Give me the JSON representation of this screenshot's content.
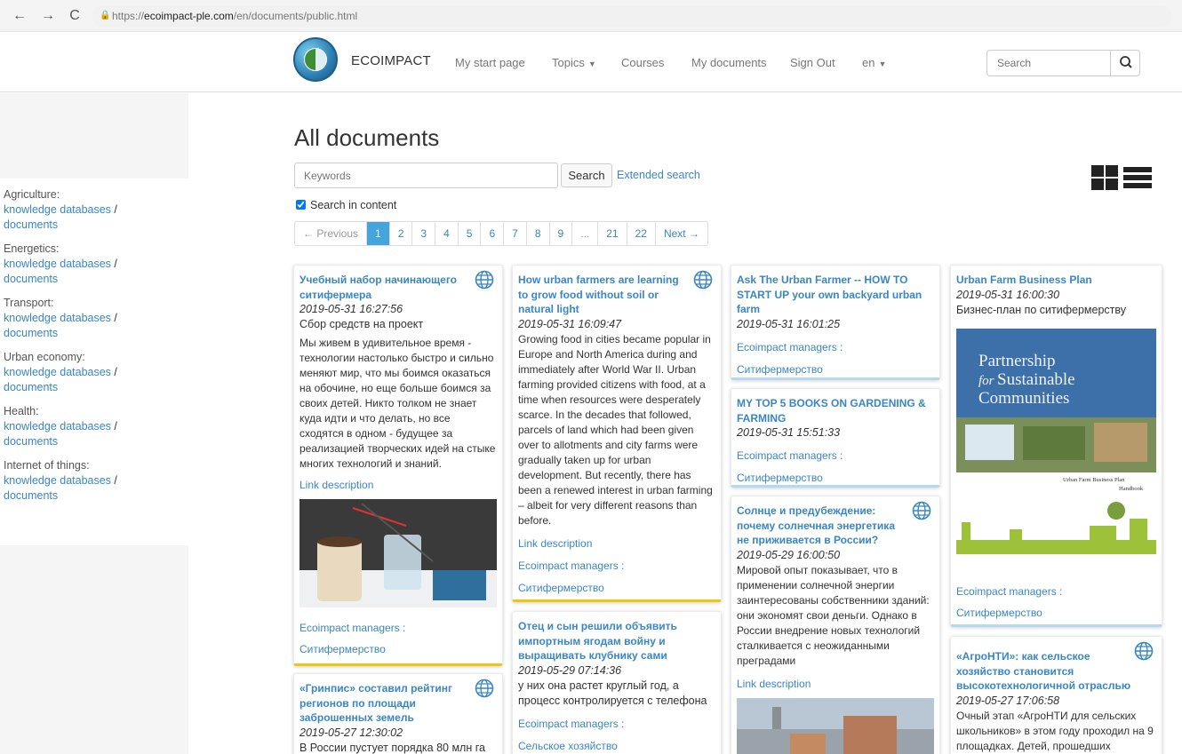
{
  "browser": {
    "back": "←",
    "forward": "→",
    "reload": "C",
    "url_domain": "ecoimpact-ple.com",
    "url_prefix": "https://",
    "url_path": "/en/documents/public.html"
  },
  "navbar": {
    "brand": "ECOIMPACT",
    "links": [
      "My start page",
      "Topics",
      "Courses",
      "My documents",
      "Sign Out",
      "en"
    ],
    "search_placeholder": "Search"
  },
  "sidebar": [
    {
      "name": "Agriculture:",
      "kb": "knowledge databases",
      "sep": " /",
      "docs": "documents"
    },
    {
      "name": "Energetics:",
      "kb": "knowledge databases",
      "sep": " /",
      "docs": "documents"
    },
    {
      "name": "Transport:",
      "kb": "knowledge databases",
      "sep": " /",
      "docs": "documents"
    },
    {
      "name": "Urban economy:",
      "kb": "knowledge databases",
      "sep": " /",
      "docs": "documents"
    },
    {
      "name": "Health:",
      "kb": "knowledge databases",
      "sep": " /",
      "docs": "documents"
    },
    {
      "name": "Internet of things:",
      "kb": "knowledge databases",
      "sep": " /",
      "docs": "documents"
    }
  ],
  "main": {
    "title": "All documents",
    "keywords_placeholder": "Keywords",
    "search_button": "Search",
    "extended_search": "Extended search",
    "search_in_content": "Search in content",
    "pagination": [
      "← Previous",
      "1",
      "2",
      "3",
      "4",
      "5",
      "6",
      "7",
      "8",
      "9",
      "...",
      "21",
      "22",
      "Next →"
    ]
  },
  "cards": [
    {
      "title": "Учебный набор начинающего ситифермера",
      "date": "2019-05-31 16:27:56",
      "lead": "Сбор средств на проект",
      "body": "Мы живем в удивительное время - технологии настолько быстро и сильно меняют мир, что мы боимся оказаться на обочине, но еще больше боимся за своих детей. Никто толком не знает куда идти и что делать, но все сходятся в одном - будущее за реализацией творческих идей на стыке многих технологий и знаний.",
      "link": "Link description",
      "managers": "Ecoimpact managers :",
      "tag": "Ситифермерство"
    },
    {
      "title": "«Гринпис» составил рейтинг регионов по площади заброшенных земель",
      "date": "2019-05-27 12:30:02",
      "lead": "В России пустует порядка 80 млн га"
    },
    {
      "title": "How urban farmers are learning to grow food without soil or natural light",
      "date": "2019-05-31 16:09:47",
      "body": "Growing food in cities became popular in Europe and North America during and immediately after World War II. Urban farming provided citizens with food, at a time when resources were desperately scarce. In the decades that followed, parcels of land which had been given over to allotments and city farms were gradually taken up for urban development. But recently, there has been a renewed interest in urban farming – albeit for very different reasons than before.",
      "link": "Link description",
      "managers": "Ecoimpact managers :",
      "tag": "Ситифермерство"
    },
    {
      "title": "Отец и сын решили объявить импортным ягодам войну и выращивать клубнику сами",
      "date": "2019-05-29 07:14:36",
      "lead": "у них она растет круглый год, а процесс контролируется с телефона",
      "managers": "Ecoimpact managers :",
      "tag": "Сельское хозяйство"
    },
    {
      "title": "Ask The Urban Farmer -- HOW TO START UP your own backyard urban farm",
      "date": "2019-05-31 16:01:25",
      "managers": "Ecoimpact managers :",
      "tag": "Ситифермерство"
    },
    {
      "title": "MY TOP 5 BOOKS ON GARDENING & FARMING",
      "date": "2019-05-31 15:51:33",
      "managers": "Ecoimpact managers :",
      "tag": "Ситифермерство"
    },
    {
      "title": "Солнце и предубеждение: почему солнечная энергетика не приживается в России?",
      "date": "2019-05-29 16:00:50",
      "body": "Мировой опыт показывает, что в применении солнечной энергии заинтересованы собственники зданий: они экономят свои деньги. Однако в России внедрение новых технологий сталкивается с неожиданными преградами",
      "link": "Link description"
    },
    {
      "title": "Urban Farm Business Plan",
      "date": "2019-05-31 16:00:30",
      "lead": "Бизнес-план по ситифермерству",
      "cover_line1": "Partnership",
      "cover_line2": "for",
      "cover_line2b": "Sustainable",
      "cover_line3": "Communities",
      "cover_caption": "Urban Farm Business Plan",
      "cover_caption2": "Handbook",
      "managers": "Ecoimpact managers :",
      "tag": "Ситифермерство"
    },
    {
      "title": "«АгроНТИ»: как сельское хозяйство становится высокотехнологичной отраслью",
      "date": "2019-05-27 17:06:58",
      "body": "Очный этап «АгроНТИ для сельских школьников» в этом году проходил на 9 площадках. Детей, прошедших"
    }
  ],
  "colors": {
    "link": "#3a86c4",
    "accent_yellow": "#f1c40f",
    "accent_blue": "#b7d8ef",
    "active_page": "#45a4db"
  }
}
